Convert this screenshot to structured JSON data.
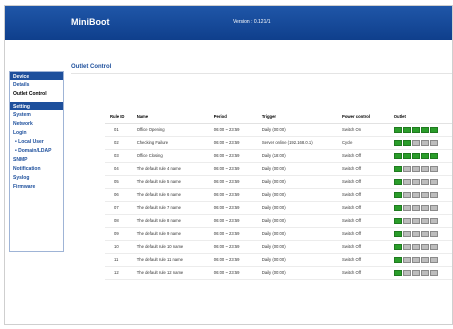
{
  "header": {
    "brand": "MiniBoot",
    "version": "Version : 0.121/1"
  },
  "sidebar": {
    "sections": [
      {
        "title": "Device",
        "items": [
          "Details",
          "Outlet Control"
        ]
      },
      {
        "title": "Setting",
        "items": [
          "System",
          "Network",
          "Login",
          "Local User",
          "Domain/LDAP",
          "SNMP",
          "Notification",
          "Syslog",
          "Firmware"
        ]
      }
    ]
  },
  "page": {
    "title": "Outlet Control"
  },
  "table": {
    "headers": [
      "Rule ID",
      "Name",
      "Period",
      "Trigger",
      "Power control",
      "Outlet"
    ],
    "rows": [
      {
        "id": "01",
        "name": "Office Opening",
        "period": "06:00 ~ 23:59",
        "trigger": "Daily (00:00)",
        "power": "Switch On",
        "outlets": [
          1,
          1,
          1,
          1,
          1
        ]
      },
      {
        "id": "02",
        "name": "Checking Failure",
        "period": "06:00 ~ 23:59",
        "trigger": "Server online (192.168.0.1)",
        "power": "Cycle",
        "outlets": [
          1,
          1,
          0,
          0,
          0
        ]
      },
      {
        "id": "03",
        "name": "Office Closing",
        "period": "06:00 ~ 23:59",
        "trigger": "Daily (18:00)",
        "power": "Switch Off",
        "outlets": [
          1,
          1,
          1,
          1,
          1
        ]
      },
      {
        "id": "04",
        "name": "The default rule 4 name",
        "period": "06:00 ~ 23:59",
        "trigger": "Daily (00:00)",
        "power": "Switch Off",
        "outlets": [
          1,
          0,
          0,
          0,
          0
        ]
      },
      {
        "id": "05",
        "name": "The default rule 5 name",
        "period": "06:00 ~ 23:59",
        "trigger": "Daily (00:00)",
        "power": "Switch Off",
        "outlets": [
          1,
          0,
          0,
          0,
          0
        ]
      },
      {
        "id": "06",
        "name": "The default rule 6 name",
        "period": "06:00 ~ 23:59",
        "trigger": "Daily (00:00)",
        "power": "Switch Off",
        "outlets": [
          1,
          0,
          0,
          0,
          0
        ]
      },
      {
        "id": "07",
        "name": "The default rule 7 name",
        "period": "06:00 ~ 23:59",
        "trigger": "Daily (00:00)",
        "power": "Switch Off",
        "outlets": [
          1,
          0,
          0,
          0,
          0
        ]
      },
      {
        "id": "08",
        "name": "The default rule 8 name",
        "period": "06:00 ~ 23:59",
        "trigger": "Daily (00:00)",
        "power": "Switch Off",
        "outlets": [
          1,
          0,
          0,
          0,
          0
        ]
      },
      {
        "id": "09",
        "name": "The default rule 9 name",
        "period": "06:00 ~ 23:59",
        "trigger": "Daily (00:00)",
        "power": "Switch Off",
        "outlets": [
          1,
          0,
          0,
          0,
          0
        ]
      },
      {
        "id": "10",
        "name": "The default rule 10 name",
        "period": "06:00 ~ 23:59",
        "trigger": "Daily (00:00)",
        "power": "Switch Off",
        "outlets": [
          1,
          0,
          0,
          0,
          0
        ]
      },
      {
        "id": "11",
        "name": "The default rule 11 name",
        "period": "06:00 ~ 23:59",
        "trigger": "Daily (00:00)",
        "power": "Switch Off",
        "outlets": [
          1,
          0,
          0,
          0,
          0
        ]
      },
      {
        "id": "12",
        "name": "The default rule 12 name",
        "period": "06:00 ~ 23:59",
        "trigger": "Daily (00:00)",
        "power": "Switch Off",
        "outlets": [
          1,
          0,
          0,
          0,
          0
        ]
      }
    ]
  },
  "colors": {
    "header": "#1d4f9c",
    "on": "#2a9d2a",
    "off": "#bdbdbd"
  }
}
